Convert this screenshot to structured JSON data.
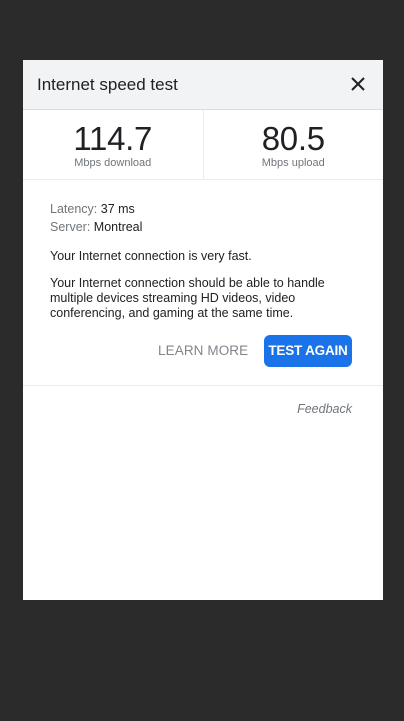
{
  "dialog": {
    "title": "Internet speed test",
    "close_icon": "close-icon"
  },
  "metrics": {
    "download": {
      "value": "114.7",
      "unit": "Mbps download"
    },
    "upload": {
      "value": "80.5",
      "unit": "Mbps upload"
    }
  },
  "details": {
    "latency_label": "Latency:",
    "latency_value": "37 ms",
    "server_label": "Server:",
    "server_value": "Montreal",
    "speed_summary": "Your Internet connection is very fast.",
    "description": "Your Internet connection should be able to handle multiple devices streaming HD videos, video conferencing, and gaming at the same time."
  },
  "actions": {
    "learn_more": "LEARN MORE",
    "test_again": "TEST AGAIN"
  },
  "footer": {
    "feedback": "Feedback"
  },
  "colors": {
    "background": "#2b2b2b",
    "header_bg": "#f1f3f4",
    "accent": "#1a73e8"
  }
}
